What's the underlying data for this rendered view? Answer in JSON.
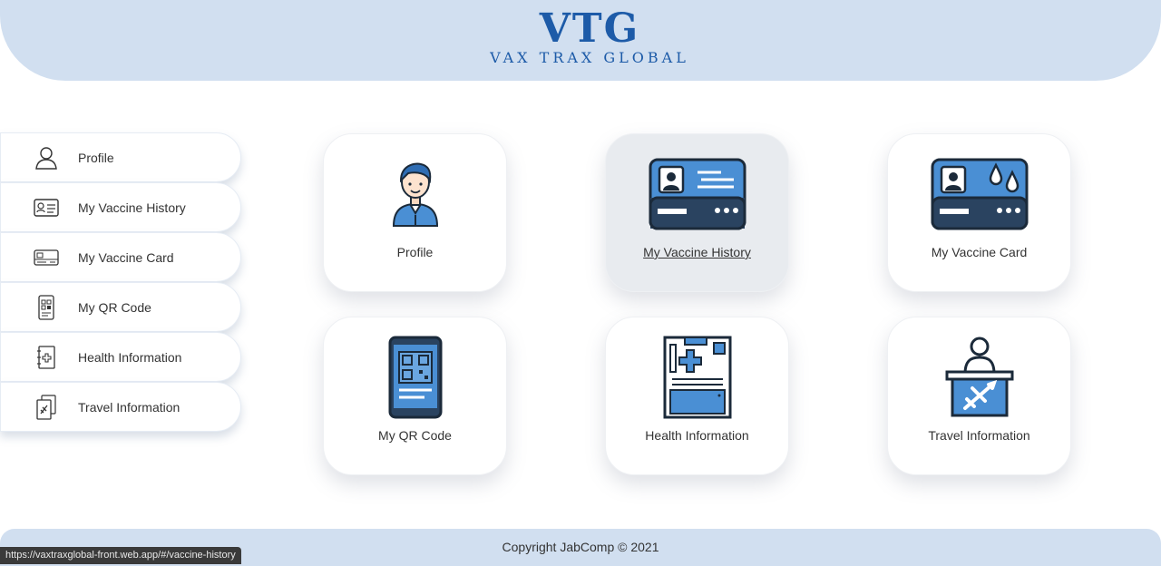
{
  "header": {
    "logo_mark": "VTG",
    "logo_subtitle": "VAX TRAX GLOBAL",
    "brand_color": "#1d5ba8",
    "band_color": "#d1dff0"
  },
  "sidebar": {
    "items": [
      {
        "label": "Profile",
        "icon": "user-outline-icon"
      },
      {
        "label": "My Vaccine History",
        "icon": "id-card-icon"
      },
      {
        "label": "My Vaccine Card",
        "icon": "card-icon"
      },
      {
        "label": "My QR Code",
        "icon": "qr-phone-icon"
      },
      {
        "label": "Health Information",
        "icon": "medical-notebook-icon"
      },
      {
        "label": "Travel Information",
        "icon": "travel-document-icon"
      }
    ]
  },
  "cards": [
    {
      "label": "Profile",
      "icon": "profile-avatar-icon"
    },
    {
      "label": "My Vaccine History",
      "icon": "vaccine-history-card-icon",
      "active": true
    },
    {
      "label": "My Vaccine Card",
      "icon": "vaccine-card-drops-icon"
    },
    {
      "label": "My QR Code",
      "icon": "qr-code-phone-icon"
    },
    {
      "label": "Health Information",
      "icon": "health-record-icon"
    },
    {
      "label": "Travel Information",
      "icon": "travel-desk-plane-icon"
    }
  ],
  "footer": {
    "copyright": "Copyright JabComp © 2021"
  },
  "status_bar": {
    "url": "https://vaxtraxglobal-front.web.app/#/vaccine-history"
  }
}
